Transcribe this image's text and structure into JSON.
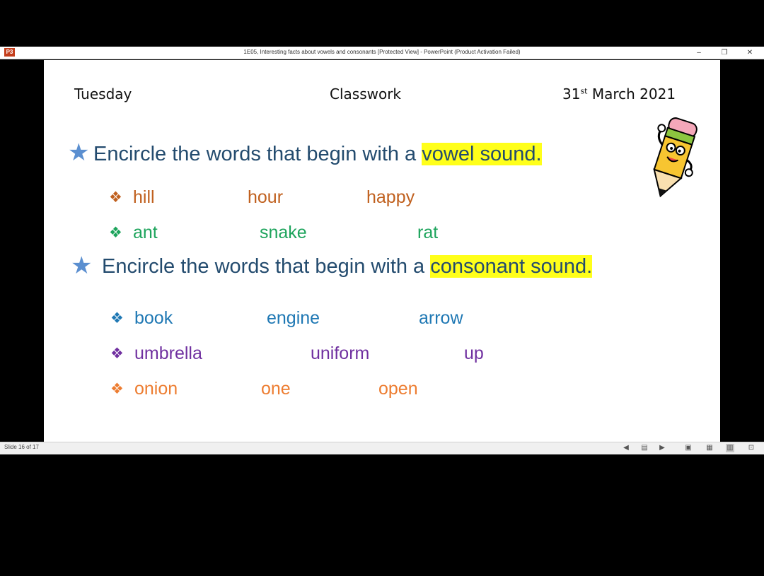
{
  "window": {
    "title": "1E05, Interesting facts about vowels and consonants [Protected View] - PowerPoint (Product Activation Failed)",
    "app_icon_label": "P3",
    "minimize_glyph": "–",
    "restore_glyph": "❐",
    "close_glyph": "✕"
  },
  "slide": {
    "day": "Tuesday",
    "header_center": "Classwork",
    "date_day": "31",
    "date_sup": "st",
    "date_rest": "March 2021",
    "q1_text": "Encircle the words that begin with a ",
    "q1_highlight": "vowel sound.",
    "q2_text": "Encircle the words that begin with a ",
    "q2_highlight": "consonant sound.",
    "bullet_glyph": "❖",
    "star_glyph": "★",
    "rows": [
      {
        "words": [
          "hill",
          "hour",
          "happy"
        ],
        "color": "#c0601e"
      },
      {
        "words": [
          "ant",
          "snake",
          "rat"
        ],
        "color": "#1da45c"
      },
      {
        "words": [
          "book",
          "engine",
          "arrow"
        ],
        "color": "#1f78b4"
      },
      {
        "words": [
          "umbrella",
          "uniform",
          "up"
        ],
        "color": "#7030a0"
      },
      {
        "words": [
          "onion",
          "one",
          "open"
        ],
        "color": "#ed7d31"
      }
    ]
  },
  "status": {
    "slide_counter": "Slide 16 of 17"
  },
  "colors": {
    "question": "#234b6e",
    "highlight": "#ffff1a",
    "star": "#5b8fd0"
  }
}
